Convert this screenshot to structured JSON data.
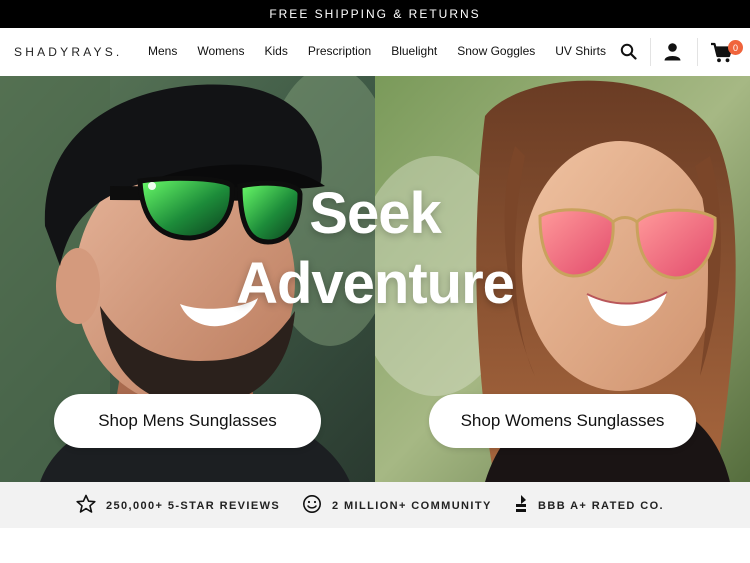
{
  "promo": {
    "text": "FREE SHIPPING & RETURNS"
  },
  "header": {
    "logo": "SHADYRAYS.",
    "nav": [
      "Mens",
      "Womens",
      "Kids",
      "Prescription",
      "Bluelight",
      "Snow Goggles",
      "UV Shirts"
    ],
    "icons": [
      "search-icon",
      "account-icon",
      "cart-icon"
    ],
    "cart_count": "0",
    "cart_badge_color": "#f0643c"
  },
  "hero": {
    "title_line1": "Seek",
    "title_line2": "Adventure",
    "btn_mens": "Shop Mens Sunglasses",
    "btn_womens": "Shop Womens Sunglasses"
  },
  "trust": [
    {
      "icon": "star-icon",
      "text": "250,000+ 5-STAR REVIEWS"
    },
    {
      "icon": "smiley-icon",
      "text": "2 MILLION+ COMMUNITY"
    },
    {
      "icon": "bbb-icon",
      "text": "BBB A+ RATED CO."
    }
  ]
}
